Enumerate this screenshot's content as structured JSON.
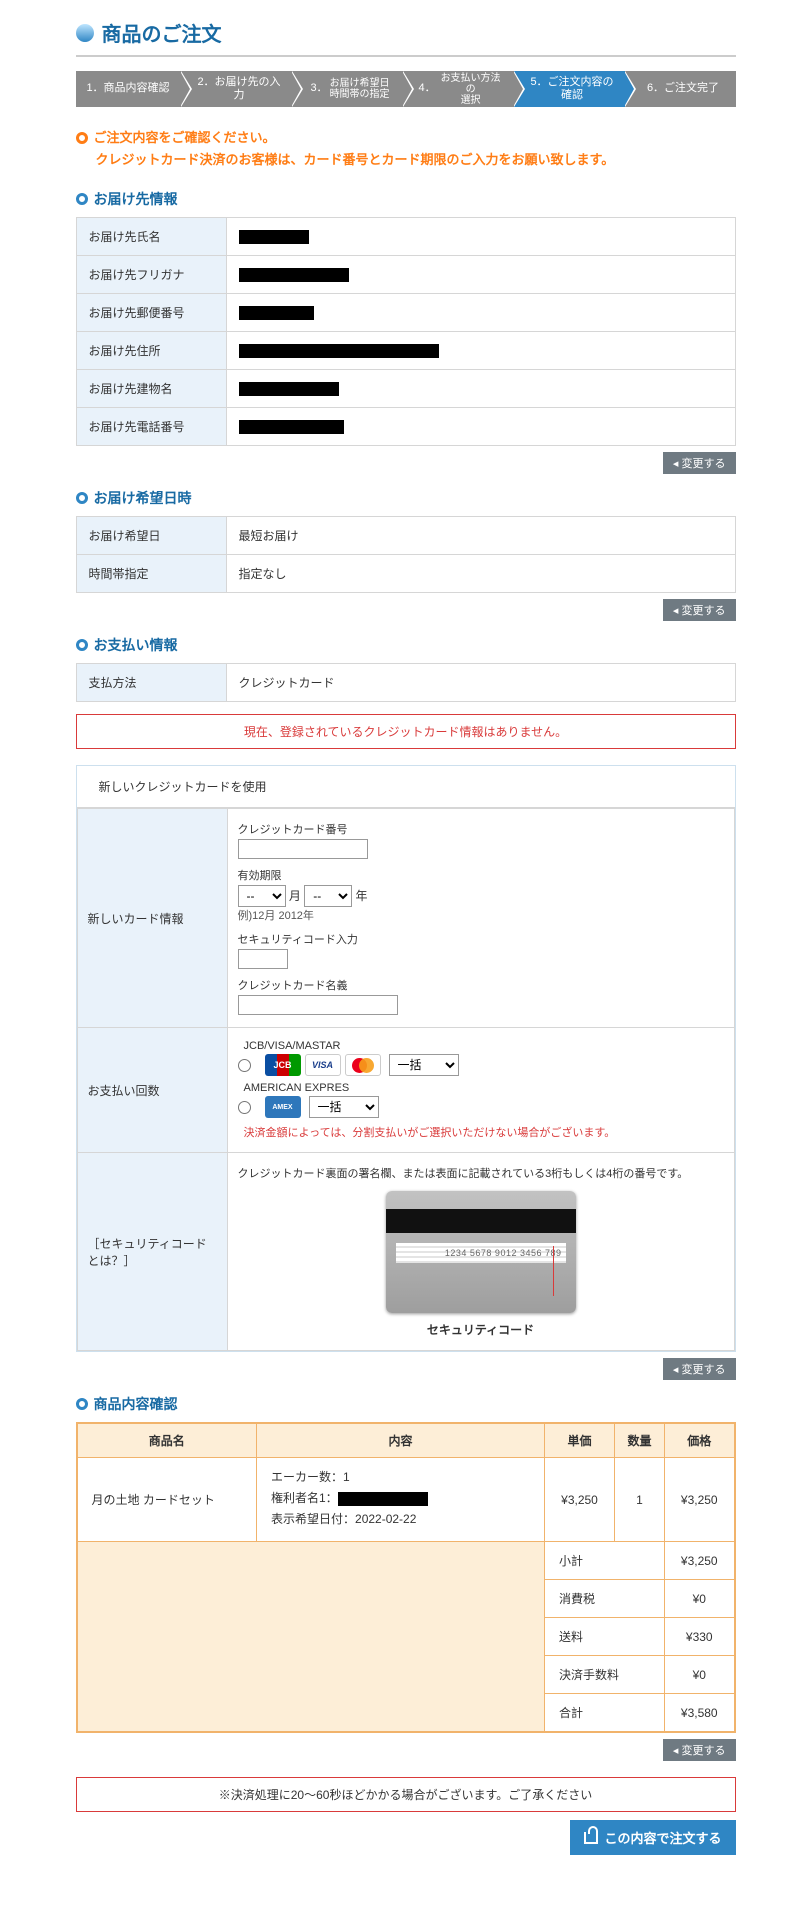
{
  "page": {
    "title": "商品のご注文"
  },
  "steps": [
    {
      "label": "1．商品内容確認"
    },
    {
      "label": "2．お届け先の入力"
    },
    {
      "label_l1": "3．",
      "label_l2a": "お届け希望日",
      "label_l2b": "時間帯の指定"
    },
    {
      "label_l1": "4．",
      "label_l2a": "お支払い方法の",
      "label_l2b": "選択"
    },
    {
      "label": "5．ご注文内容の確認"
    },
    {
      "label": "6．ご注文完了"
    }
  ],
  "alert": {
    "title": "ご注文内容をご確認ください。",
    "sub": "クレジットカード決済のお客様は、カード番号とカード期限のご入力をお願い致します。"
  },
  "sections": {
    "delivery_info": "お届け先情報",
    "delivery_date": "お届け希望日時",
    "payment_info": "お支払い情報",
    "product_check": "商品内容確認"
  },
  "delivery": {
    "labels": {
      "name": "お届け先氏名",
      "furigana": "お届け先フリガナ",
      "postal": "お届け先郵便番号",
      "address": "お届け先住所",
      "building": "お届け先建物名",
      "phone": "お届け先電話番号"
    }
  },
  "delivery_date": {
    "labels": {
      "date": "お届け希望日",
      "time": "時間帯指定"
    },
    "values": {
      "date": "最短お届け",
      "time": "指定なし"
    }
  },
  "payment": {
    "method_label": "支払方法",
    "method_value": "クレジットカード",
    "no_card_notice": "現在、登録されているクレジットカード情報はありません。",
    "new_card_head": "新しいクレジットカードを使用",
    "card_info_label": "新しいカード情報",
    "cc_number_label": "クレジットカード番号",
    "expiry_label": "有効期限",
    "expiry_month_placeholder": "--",
    "expiry_year_placeholder": "--",
    "month_unit": "月",
    "year_unit": "年",
    "expiry_hint": "例)12月 2012年",
    "seccode_label": "セキュリティコード入力",
    "cardname_label": "クレジットカード名義",
    "pay_count_label": "お支払い回数",
    "brand_jvm": "JCB/VISA/MASTAR",
    "brand_amex": "AMERICAN EXPRES",
    "installments_default": "一括",
    "installments_warn": "決済金額によっては、分割支払いがご選択いただけない場合がございます。",
    "sec_q_label": "［セキュリティコードとは？］",
    "sec_desc": "クレジットカード裏面の署名欄、または表面に記載されている3桁もしくは4桁の番号です。",
    "card_sample_digits": "1234 5678 9012 3456 789",
    "sec_caption": "セキュリティコード"
  },
  "product": {
    "headers": {
      "name": "商品名",
      "content": "内容",
      "unit_price": "単価",
      "qty": "数量",
      "price": "価格"
    },
    "item": {
      "name": "月の土地 カードセット",
      "acre_label": "エーカー数：",
      "acre_value": "1",
      "holder_label": "権利者名1：",
      "date_label": "表示希望日付：",
      "date_value": "2022-02-22",
      "unit_price": "¥3,250",
      "qty": "1",
      "price": "¥3,250"
    },
    "totals": {
      "subtotal_label": "小計",
      "subtotal": "¥3,250",
      "tax_label": "消費税",
      "tax": "¥0",
      "shipping_label": "送料",
      "shipping": "¥330",
      "fee_label": "決済手数料",
      "fee": "¥0",
      "total_label": "合計",
      "total": "¥3,580"
    }
  },
  "buttons": {
    "change": "◂ 変更する",
    "order": "この内容で注文する"
  },
  "bottom_notice": "※決済処理に20～60秒ほどかかる場合がございます。ご了承ください"
}
